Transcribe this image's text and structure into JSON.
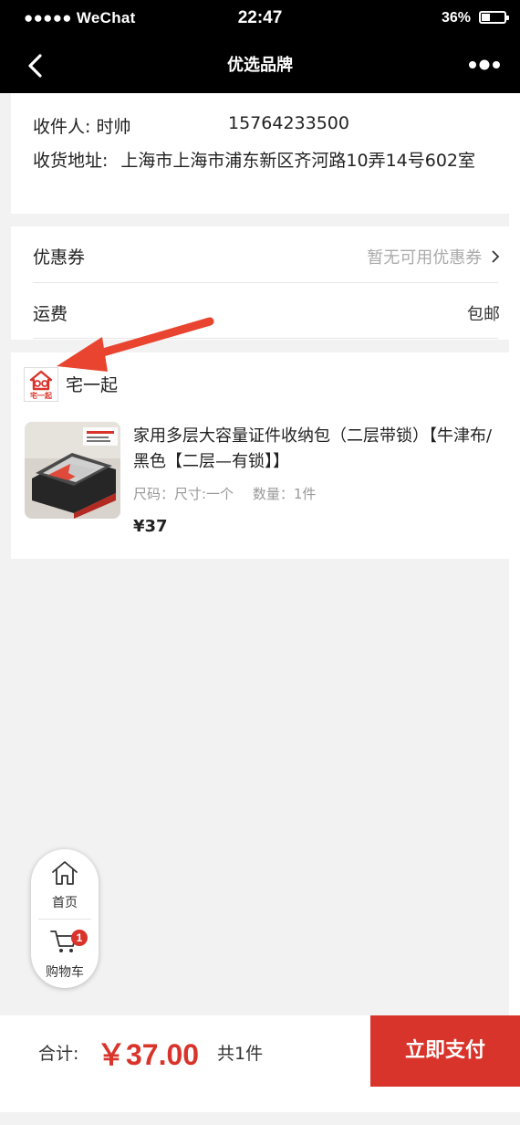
{
  "status_bar": {
    "carrier": "●●●●● WeChat",
    "time": "22:47",
    "battery": "36%",
    "battery_level": 0.36
  },
  "nav": {
    "title": "优选品牌"
  },
  "address": {
    "recipient_label": "收件人:",
    "recipient_name": "时帅",
    "phone": "15764233500",
    "address_label": "收货地址:",
    "address_text": "上海市上海市浦东新区齐河路10弄14号602室"
  },
  "coupon": {
    "label": "优惠券",
    "value": "暂无可用优惠券"
  },
  "shipping": {
    "label": "运费",
    "value": "包邮"
  },
  "shop": {
    "name": "宅一起",
    "logo_text": "宅一起",
    "product": {
      "title": "家用多层大容量证件收纳包（二层带锁）【牛津布/黑色【二层—有锁】】",
      "spec_size": "尺码：尺寸:一个",
      "spec_qty": "数量：1件",
      "price": "¥37"
    }
  },
  "float_menu": {
    "home_label": "首页",
    "cart_label": "购物车",
    "cart_badge": "1"
  },
  "bottom": {
    "total_label": "合计:",
    "total_amount": "￥37.00",
    "count_text": "共1件",
    "pay_label": "立即支付"
  },
  "colors": {
    "accent": "#d9342b",
    "nav_bg": "#000000",
    "arrow": "#e8442f"
  },
  "icons": [
    "back-chevron-icon",
    "more-dots-icon",
    "chevron-right-icon",
    "home-icon",
    "cart-icon"
  ]
}
